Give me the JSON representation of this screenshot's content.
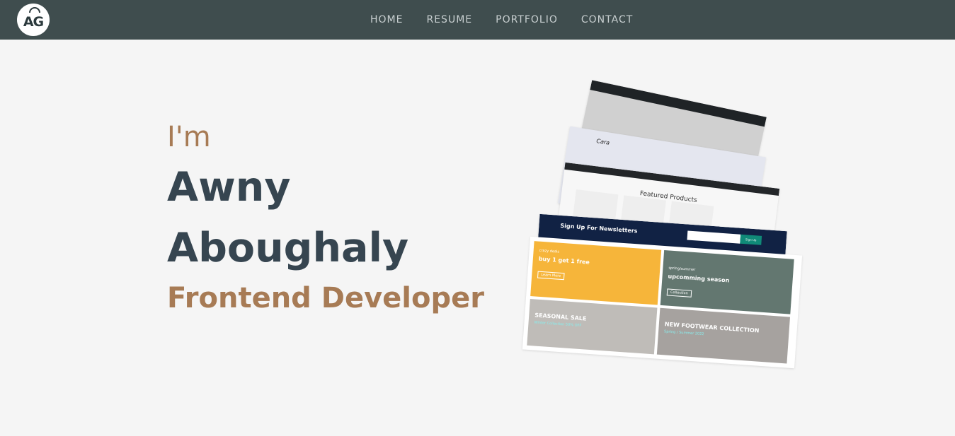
{
  "nav": {
    "logo_text": "AG",
    "links": [
      "HOME",
      "RESUME",
      "PORTFOLIO",
      "CONTACT"
    ]
  },
  "hero": {
    "greeting": "I'm",
    "first_name": "Awny",
    "last_name": "Aboughaly",
    "role": "Frontend Developer"
  },
  "collage": {
    "logo_small": "Cara",
    "featured_title": "Featured Products",
    "newsletter_title": "Sign Up For Newsletters",
    "newsletter_button": "Sign Up",
    "tile1_small": "crazy deals",
    "tile1_title": "buy 1 get 1 free",
    "tile1_btn": "Learn More",
    "tile2_small": "spring/summer",
    "tile2_title": "upcomming season",
    "tile2_btn": "Collection",
    "tile3_title": "SEASONAL SALE",
    "tile3_sub": "Winter Collection 50% OFF",
    "tile4_title": "NEW FOOTWEAR COLLECTION",
    "tile4_sub": "Spring / Summer 2022"
  },
  "colors": {
    "navbar": "#3f4d4e",
    "accent": "#a77b55",
    "name": "#364550",
    "background": "#f5f5f5"
  }
}
